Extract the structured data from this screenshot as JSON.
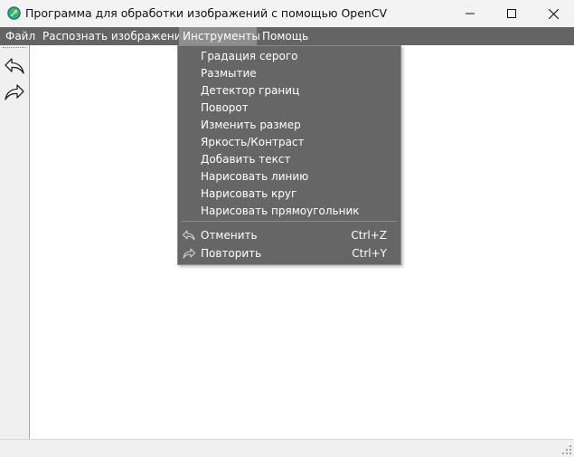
{
  "window": {
    "title": "Программа для обработки изображений с помощью OpenCV",
    "icon": "app-logo-icon"
  },
  "menubar": {
    "items": [
      "Файл",
      "Распознать изображение",
      "Инструменты",
      "Помощь"
    ],
    "active": "Инструменты"
  },
  "toolbar": {
    "undo_icon": "undo-icon",
    "redo_icon": "redo-icon"
  },
  "tools_menu": {
    "items": [
      "Градация серого",
      "Размытие",
      "Детектор границ",
      "Поворот",
      "Изменить размер",
      "Яркость/Контраст",
      "Добавить текст",
      "Нарисовать линию",
      "Нарисовать круг",
      "Нарисовать прямоугольник"
    ],
    "undo": {
      "label": "Отменить",
      "shortcut": "Ctrl+Z",
      "icon": "undo-icon"
    },
    "redo": {
      "label": "Повторить",
      "shortcut": "Ctrl+Y",
      "icon": "redo-icon"
    }
  },
  "colors": {
    "menubar_bg": "#646464",
    "menu_active_bg": "#8f8f8f",
    "dropdown_bg": "#666666",
    "titlebar_bg": "#f3f3f3"
  }
}
